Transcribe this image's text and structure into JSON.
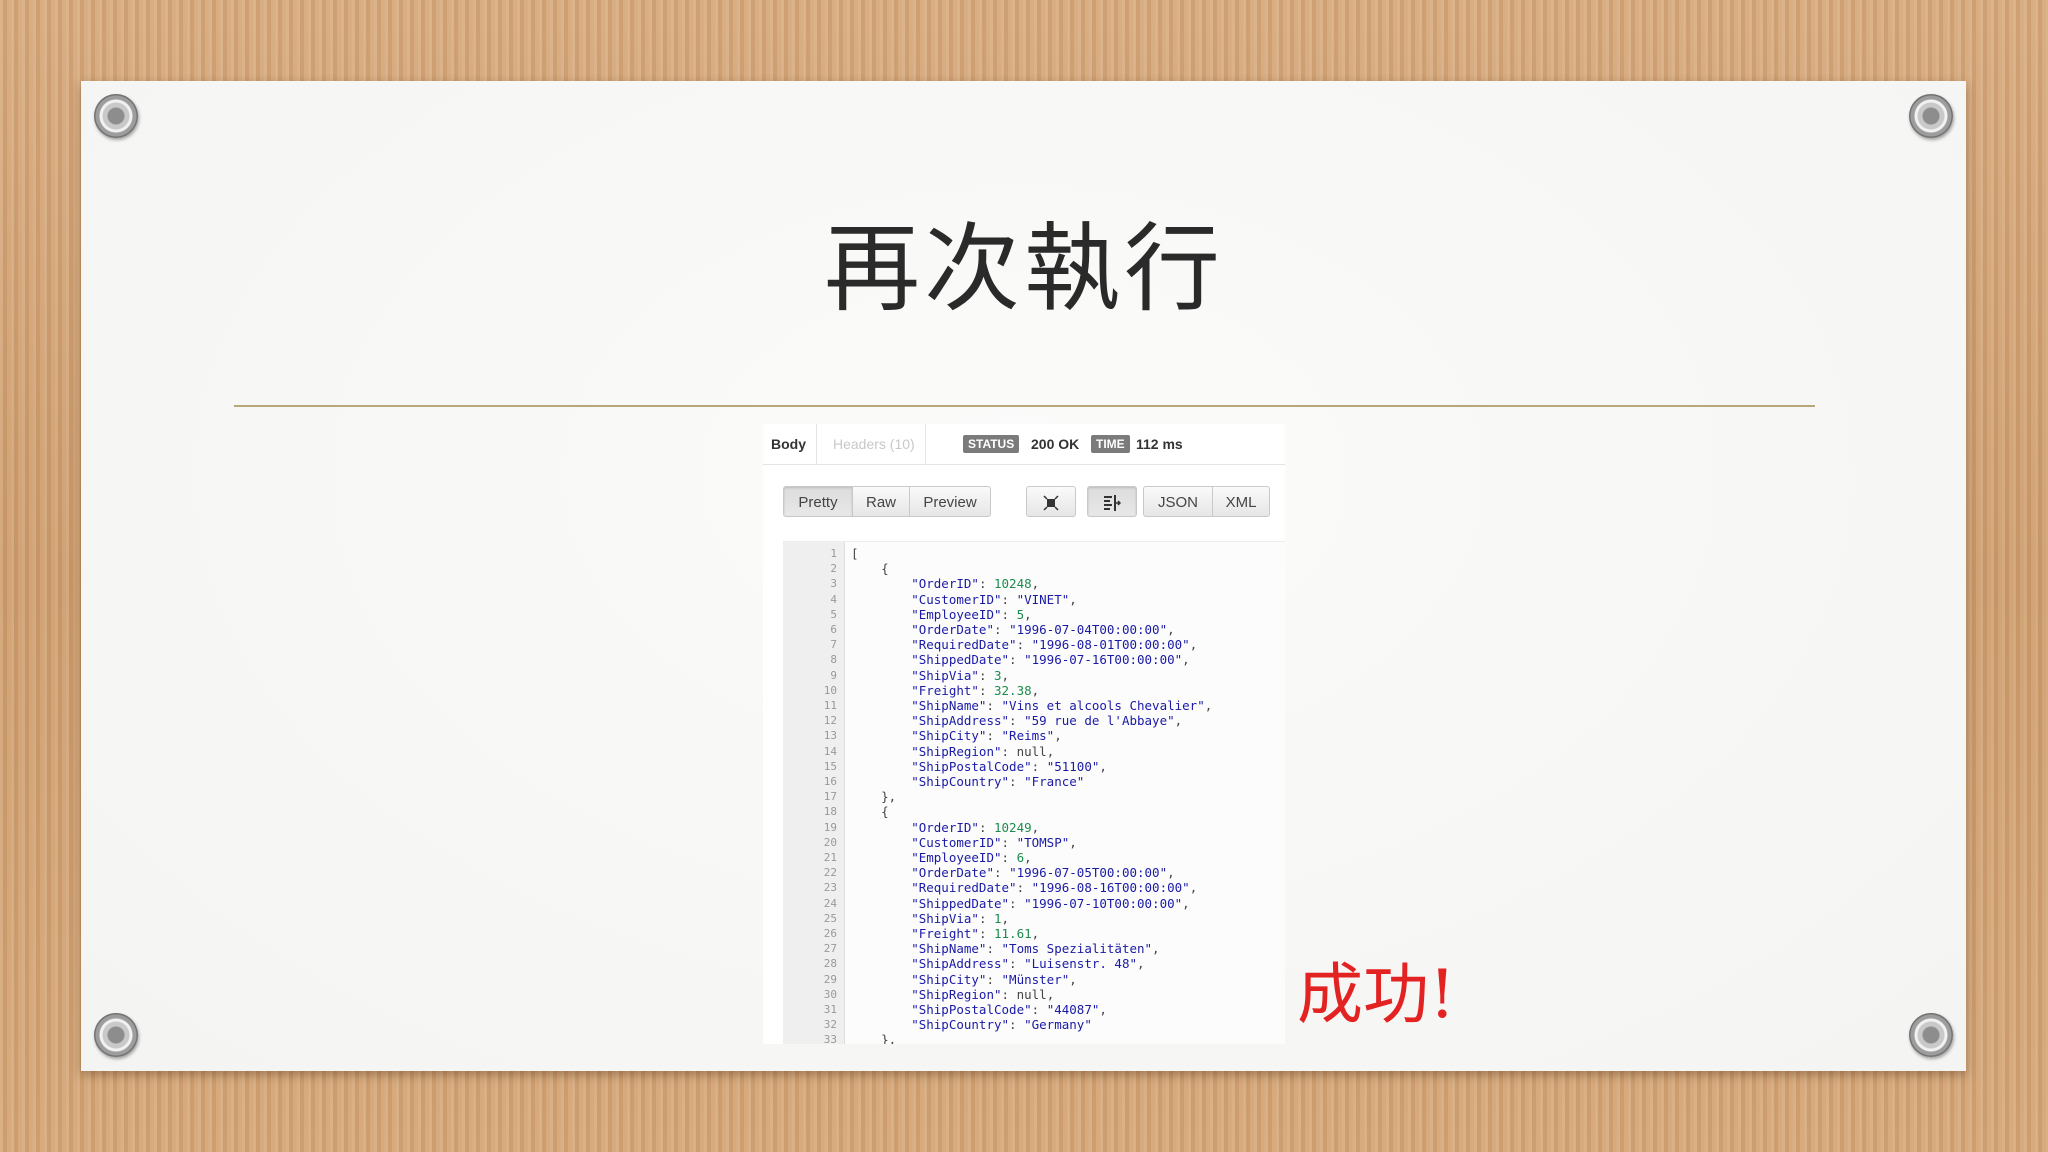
{
  "slide": {
    "title": "再次執行",
    "success_text": "成功!"
  },
  "response_panel": {
    "tabs": {
      "body": "Body",
      "headers": "Headers (10)"
    },
    "status_label": "STATUS",
    "status_value": "200 OK",
    "time_label": "TIME",
    "time_value": "112 ms",
    "view_buttons": {
      "pretty": "Pretty",
      "raw": "Raw",
      "preview": "Preview"
    },
    "format_buttons": {
      "json": "JSON",
      "xml": "XML"
    },
    "icons": {
      "expand": "expand-icon",
      "wrap": "wrap-lines-icon"
    }
  },
  "code_lines": [
    [
      [
        "p",
        "["
      ]
    ],
    [
      [
        "p",
        "    {"
      ]
    ],
    [
      [
        "k",
        "        \"OrderID\""
      ],
      [
        "p",
        ": "
      ],
      [
        "n",
        "10248"
      ],
      [
        "p",
        ","
      ]
    ],
    [
      [
        "k",
        "        \"CustomerID\""
      ],
      [
        "p",
        ": "
      ],
      [
        "s",
        "\"VINET\""
      ],
      [
        "p",
        ","
      ]
    ],
    [
      [
        "k",
        "        \"EmployeeID\""
      ],
      [
        "p",
        ": "
      ],
      [
        "n",
        "5"
      ],
      [
        "p",
        ","
      ]
    ],
    [
      [
        "k",
        "        \"OrderDate\""
      ],
      [
        "p",
        ": "
      ],
      [
        "s",
        "\"1996-07-04T00:00:00\""
      ],
      [
        "p",
        ","
      ]
    ],
    [
      [
        "k",
        "        \"RequiredDate\""
      ],
      [
        "p",
        ": "
      ],
      [
        "s",
        "\"1996-08-01T00:00:00\""
      ],
      [
        "p",
        ","
      ]
    ],
    [
      [
        "k",
        "        \"ShippedDate\""
      ],
      [
        "p",
        ": "
      ],
      [
        "s",
        "\"1996-07-16T00:00:00\""
      ],
      [
        "p",
        ","
      ]
    ],
    [
      [
        "k",
        "        \"ShipVia\""
      ],
      [
        "p",
        ": "
      ],
      [
        "n",
        "3"
      ],
      [
        "p",
        ","
      ]
    ],
    [
      [
        "k",
        "        \"Freight\""
      ],
      [
        "p",
        ": "
      ],
      [
        "n",
        "32.38"
      ],
      [
        "p",
        ","
      ]
    ],
    [
      [
        "k",
        "        \"ShipName\""
      ],
      [
        "p",
        ": "
      ],
      [
        "s",
        "\"Vins et alcools Chevalier\""
      ],
      [
        "p",
        ","
      ]
    ],
    [
      [
        "k",
        "        \"ShipAddress\""
      ],
      [
        "p",
        ": "
      ],
      [
        "s",
        "\"59 rue de l'Abbaye\""
      ],
      [
        "p",
        ","
      ]
    ],
    [
      [
        "k",
        "        \"ShipCity\""
      ],
      [
        "p",
        ": "
      ],
      [
        "s",
        "\"Reims\""
      ],
      [
        "p",
        ","
      ]
    ],
    [
      [
        "k",
        "        \"ShipRegion\""
      ],
      [
        "p",
        ": "
      ],
      [
        "p",
        "null"
      ],
      [
        "p",
        ","
      ]
    ],
    [
      [
        "k",
        "        \"ShipPostalCode\""
      ],
      [
        "p",
        ": "
      ],
      [
        "s",
        "\"51100\""
      ],
      [
        "p",
        ","
      ]
    ],
    [
      [
        "k",
        "        \"ShipCountry\""
      ],
      [
        "p",
        ": "
      ],
      [
        "s",
        "\"France\""
      ]
    ],
    [
      [
        "p",
        "    },"
      ]
    ],
    [
      [
        "p",
        "    {"
      ]
    ],
    [
      [
        "k",
        "        \"OrderID\""
      ],
      [
        "p",
        ": "
      ],
      [
        "n",
        "10249"
      ],
      [
        "p",
        ","
      ]
    ],
    [
      [
        "k",
        "        \"CustomerID\""
      ],
      [
        "p",
        ": "
      ],
      [
        "s",
        "\"TOMSP\""
      ],
      [
        "p",
        ","
      ]
    ],
    [
      [
        "k",
        "        \"EmployeeID\""
      ],
      [
        "p",
        ": "
      ],
      [
        "n",
        "6"
      ],
      [
        "p",
        ","
      ]
    ],
    [
      [
        "k",
        "        \"OrderDate\""
      ],
      [
        "p",
        ": "
      ],
      [
        "s",
        "\"1996-07-05T00:00:00\""
      ],
      [
        "p",
        ","
      ]
    ],
    [
      [
        "k",
        "        \"RequiredDate\""
      ],
      [
        "p",
        ": "
      ],
      [
        "s",
        "\"1996-08-16T00:00:00\""
      ],
      [
        "p",
        ","
      ]
    ],
    [
      [
        "k",
        "        \"ShippedDate\""
      ],
      [
        "p",
        ": "
      ],
      [
        "s",
        "\"1996-07-10T00:00:00\""
      ],
      [
        "p",
        ","
      ]
    ],
    [
      [
        "k",
        "        \"ShipVia\""
      ],
      [
        "p",
        ": "
      ],
      [
        "n",
        "1"
      ],
      [
        "p",
        ","
      ]
    ],
    [
      [
        "k",
        "        \"Freight\""
      ],
      [
        "p",
        ": "
      ],
      [
        "n",
        "11.61"
      ],
      [
        "p",
        ","
      ]
    ],
    [
      [
        "k",
        "        \"ShipName\""
      ],
      [
        "p",
        ": "
      ],
      [
        "s",
        "\"Toms Spezialitäten\""
      ],
      [
        "p",
        ","
      ]
    ],
    [
      [
        "k",
        "        \"ShipAddress\""
      ],
      [
        "p",
        ": "
      ],
      [
        "s",
        "\"Luisenstr. 48\""
      ],
      [
        "p",
        ","
      ]
    ],
    [
      [
        "k",
        "        \"ShipCity\""
      ],
      [
        "p",
        ": "
      ],
      [
        "s",
        "\"Münster\""
      ],
      [
        "p",
        ","
      ]
    ],
    [
      [
        "k",
        "        \"ShipRegion\""
      ],
      [
        "p",
        ": "
      ],
      [
        "p",
        "null"
      ],
      [
        "p",
        ","
      ]
    ],
    [
      [
        "k",
        "        \"ShipPostalCode\""
      ],
      [
        "p",
        ": "
      ],
      [
        "s",
        "\"44087\""
      ],
      [
        "p",
        ","
      ]
    ],
    [
      [
        "k",
        "        \"ShipCountry\""
      ],
      [
        "p",
        ": "
      ],
      [
        "s",
        "\"Germany\""
      ]
    ],
    [
      [
        "p",
        "    },"
      ]
    ]
  ]
}
